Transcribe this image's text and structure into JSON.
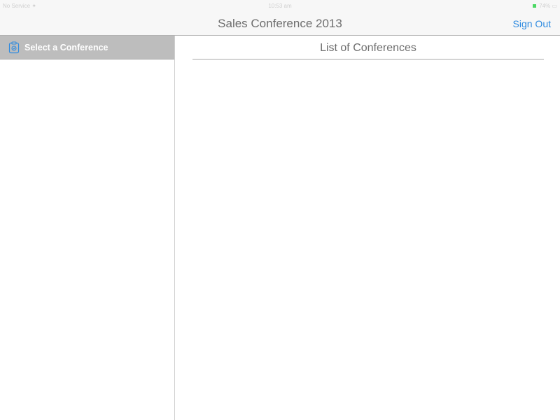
{
  "status_bar": {
    "carrier": "No Service ✦",
    "time": "10:53 am",
    "battery": "74%  ▭",
    "battery_color": "#4cd964"
  },
  "nav": {
    "title": "Sales Conference 2013",
    "sign_out_label": "Sign Out",
    "accent_color": "#2f8be0"
  },
  "sidebar": {
    "items": [
      {
        "label": "Select a Conference",
        "icon": "clipboard-icon",
        "selected": true
      }
    ]
  },
  "main": {
    "title": "List of Conferences"
  }
}
